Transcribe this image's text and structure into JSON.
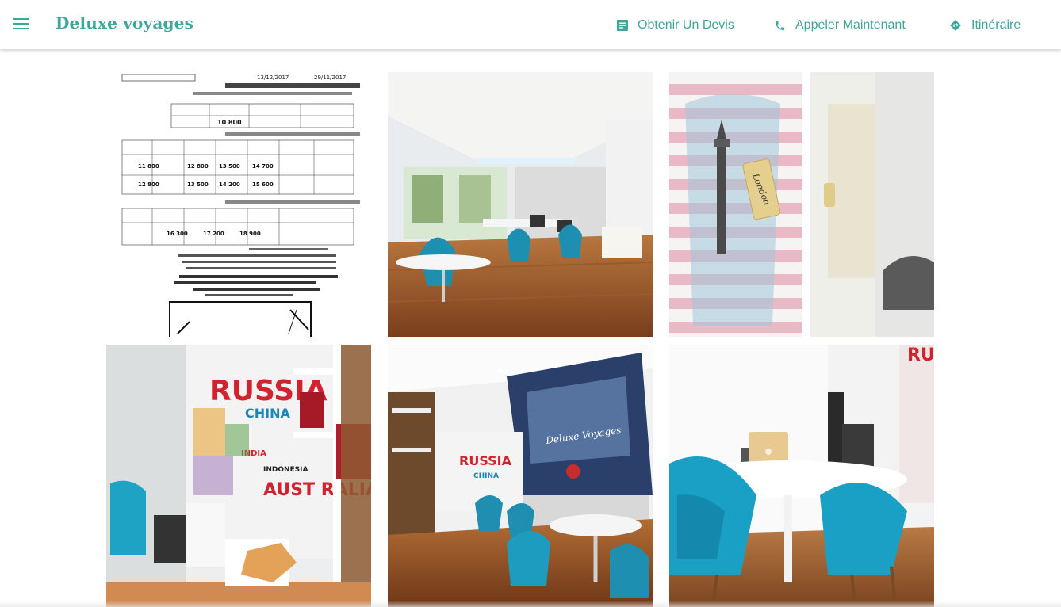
{
  "app": {
    "brand": "Deluxe voyages"
  },
  "nav": [
    {
      "label": "Obtenir Un Devis",
      "icon": "document-icon"
    },
    {
      "label": "Appeler Maintenant",
      "icon": "phone-icon"
    },
    {
      "label": "Itinéraire",
      "icon": "directions-icon"
    }
  ],
  "menu": {
    "icon": "hamburger-menu-icon"
  },
  "colors": {
    "accent": "#3fa79a",
    "chair": "#1e8fb0",
    "floor": "#8a4a22"
  },
  "gallery": [
    {
      "name": "photo-price-list",
      "subject": "printed price list flyer"
    },
    {
      "name": "photo-agency-office",
      "subject": "agency office interior"
    },
    {
      "name": "photo-london-bottle",
      "subject": "decor bottle with London tag"
    },
    {
      "name": "photo-world-map-wall",
      "subject": "world map wall with countries"
    },
    {
      "name": "photo-reception-desk",
      "subject": "reception area with branded banner"
    },
    {
      "name": "photo-meeting-table",
      "subject": "meeting table with laptop"
    }
  ],
  "flyer": {
    "line1": "13/12/2017",
    "line2": "29/11/2017",
    "prices_row1": [
      "10 800"
    ],
    "prices_row2": [
      "11 800",
      "12 800",
      "13 500",
      "14 700"
    ],
    "prices_row3": [
      "12 800",
      "13 500",
      "14 200",
      "15 600"
    ],
    "prices_row4": [
      "16 300",
      "17 200",
      "18 900"
    ]
  },
  "map_words": {
    "russia": "RUSSIA",
    "china": "CHINA",
    "indonesia": "INDONESIA",
    "australia": "AUST RALIA",
    "india": "INDIA"
  },
  "tag_text": "London",
  "banner_text": "Deluxe Voyages"
}
